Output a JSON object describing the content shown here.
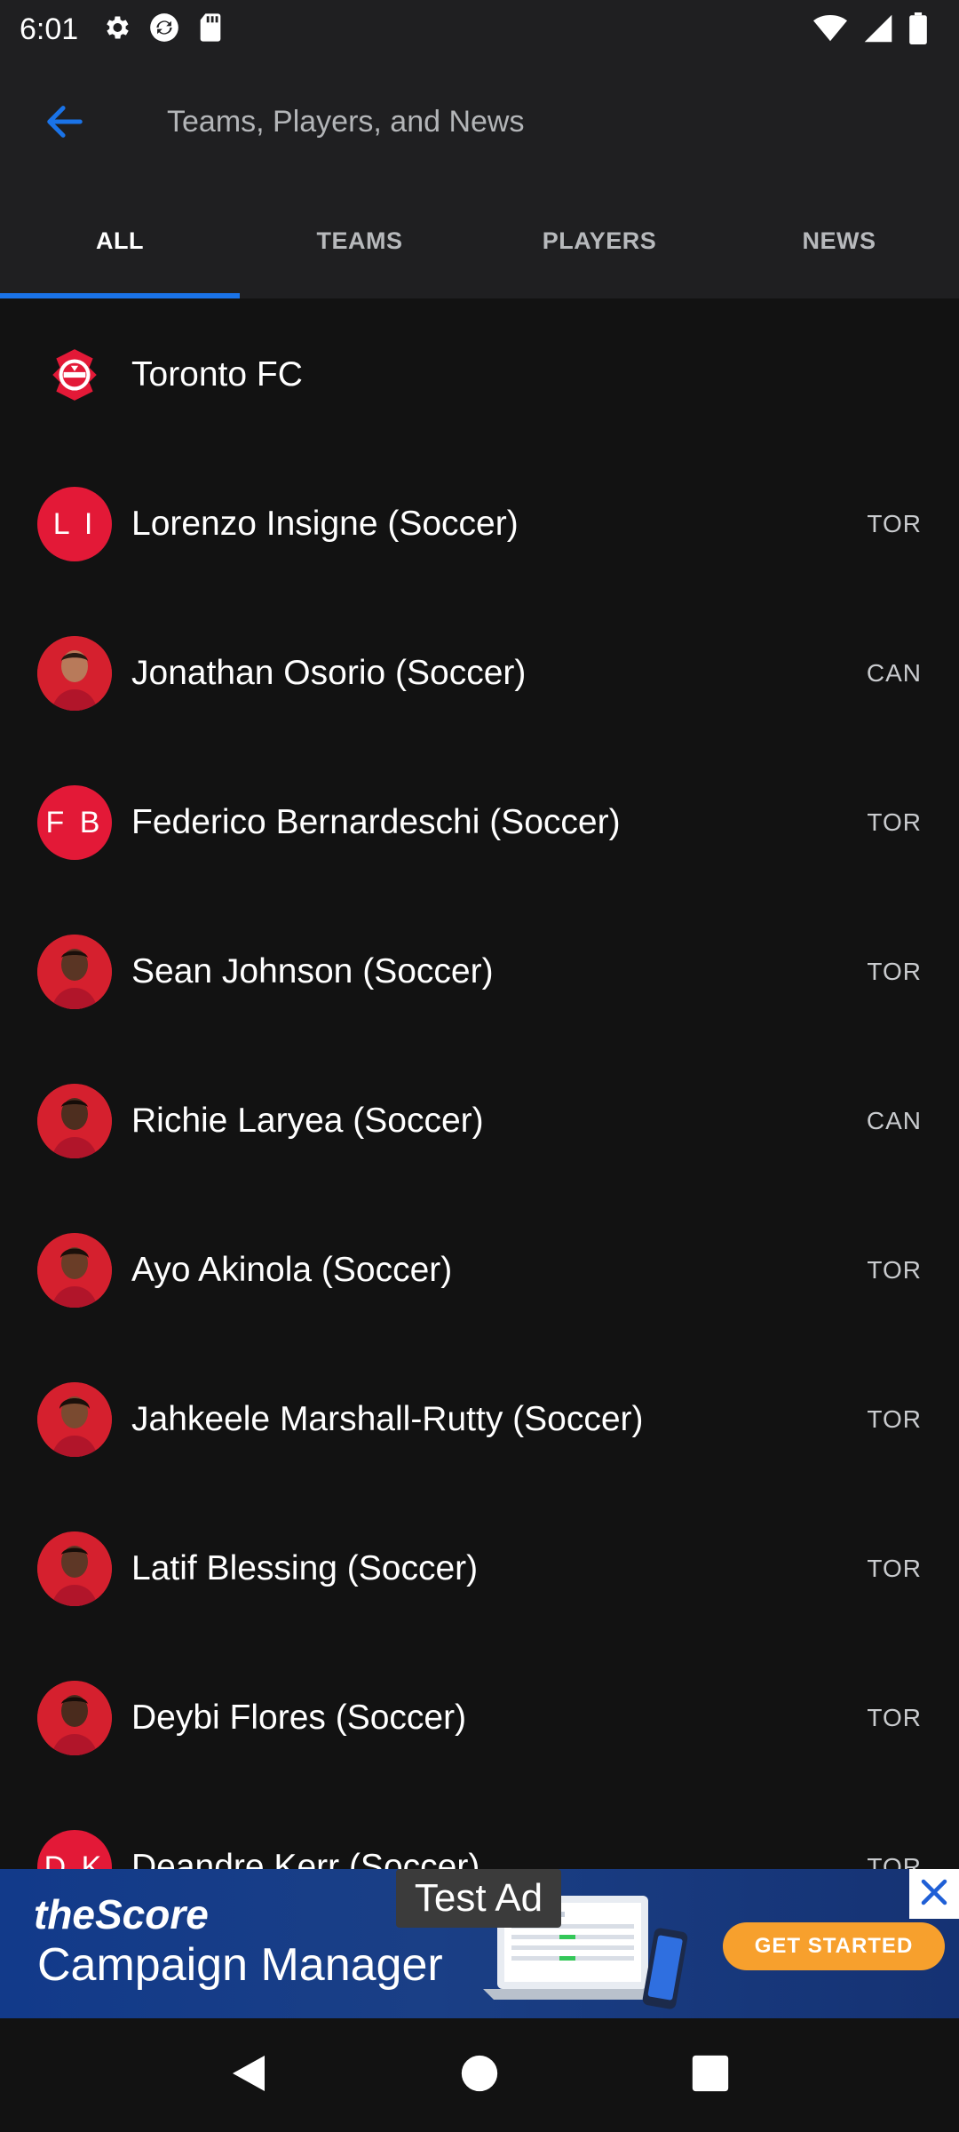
{
  "status_bar": {
    "time": "6:01",
    "left_icons": [
      "gear-icon",
      "sync-icon",
      "sd-card-icon"
    ],
    "right_icons": [
      "wifi-icon",
      "signal-icon",
      "battery-icon"
    ]
  },
  "search": {
    "placeholder": "Teams, Players, and News",
    "value": ""
  },
  "tabs": [
    {
      "label": "ALL",
      "active": true
    },
    {
      "label": "TEAMS",
      "active": false
    },
    {
      "label": "PLAYERS",
      "active": false
    },
    {
      "label": "NEWS",
      "active": false
    }
  ],
  "results": [
    {
      "type": "team",
      "name": "Toronto FC",
      "team": ""
    },
    {
      "type": "initials",
      "initials": "L I",
      "name": "Lorenzo Insigne (Soccer)",
      "team": "TOR"
    },
    {
      "type": "photo",
      "name": "Jonathan Osorio (Soccer)",
      "team": "CAN"
    },
    {
      "type": "initials",
      "initials": "F B",
      "name": "Federico Bernardeschi (Soccer)",
      "team": "TOR"
    },
    {
      "type": "photo",
      "name": "Sean Johnson (Soccer)",
      "team": "TOR"
    },
    {
      "type": "photo",
      "name": "Richie Laryea (Soccer)",
      "team": "CAN"
    },
    {
      "type": "photo",
      "name": "Ayo Akinola (Soccer)",
      "team": "TOR"
    },
    {
      "type": "photo",
      "name": "Jahkeele Marshall-Rutty (Soccer)",
      "team": "TOR"
    },
    {
      "type": "photo",
      "name": "Latif Blessing (Soccer)",
      "team": "TOR"
    },
    {
      "type": "photo",
      "name": "Deybi Flores (Soccer)",
      "team": "TOR"
    },
    {
      "type": "initials",
      "initials": "D K",
      "name": "Deandre Kerr (Soccer)",
      "team": "TOR"
    }
  ],
  "ad": {
    "label": "Test Ad",
    "brand": "theScore",
    "product": "Campaign Manager",
    "cta": "GET STARTED"
  },
  "colors": {
    "accent": "#1a73e8",
    "avatar_red": "#e31937",
    "cta_orange": "#f7a02d",
    "header_bg": "#1f1f21",
    "list_bg": "#121212"
  }
}
